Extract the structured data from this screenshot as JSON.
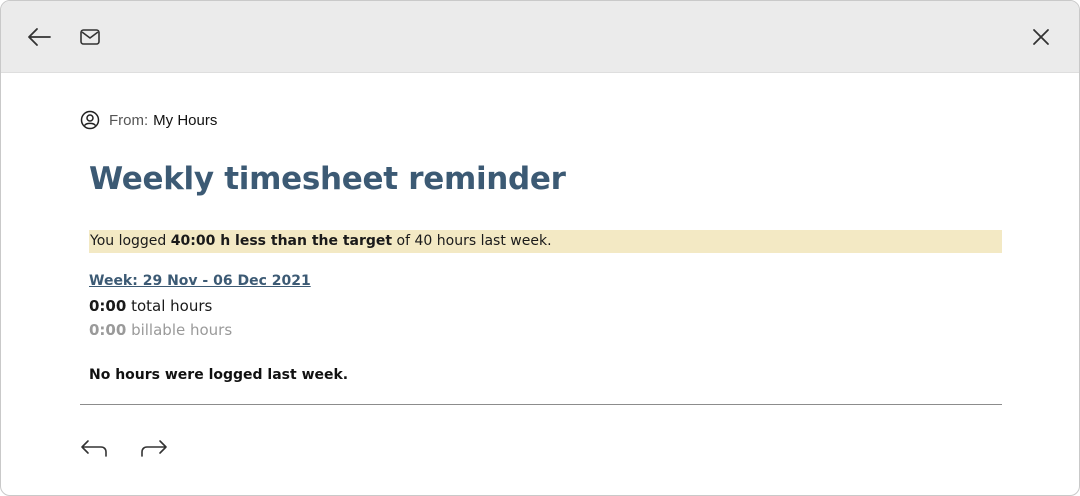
{
  "toolbar": {
    "back_icon": "arrow-left-icon",
    "mail_icon": "envelope-icon",
    "close_icon": "close-icon"
  },
  "email": {
    "from_label": "From:",
    "from_name": "My Hours",
    "title": "Weekly timesheet reminder",
    "notice": {
      "prefix": "You logged ",
      "emphasis": "40:00 h less than the target",
      "suffix": " of 40 hours last week."
    },
    "week_link": "Week: 29 Nov - 06 Dec 2021",
    "total": {
      "value": "0:00",
      "label": " total hours"
    },
    "billable": {
      "value": "0:00",
      "label": " billable hours"
    },
    "no_hours_message": "No hours were logged last week."
  },
  "actions": {
    "reply_icon": "reply-icon",
    "forward_icon": "forward-icon"
  },
  "colors": {
    "title": "#3c5a74",
    "notice_background": "#f3e9c4",
    "toolbar_background": "#ebebeb"
  }
}
